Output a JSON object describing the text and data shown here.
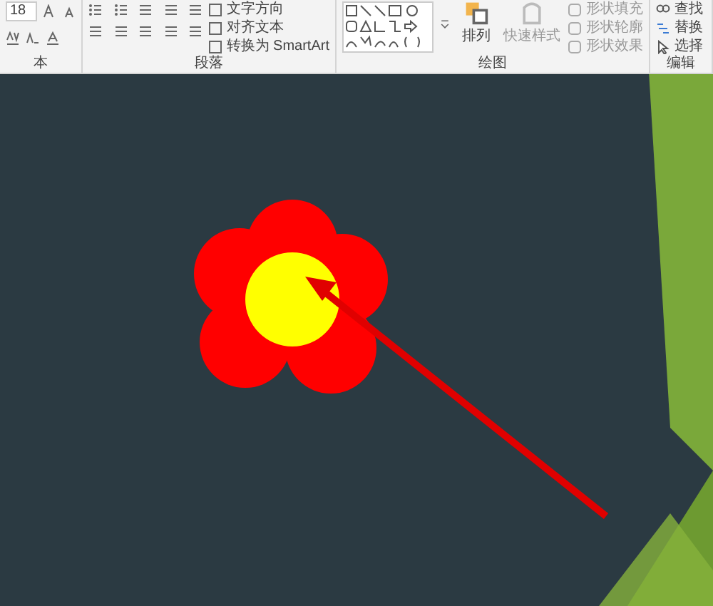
{
  "ribbon": {
    "font_group": {
      "font_size": "18",
      "label": "本"
    },
    "paragraph_group": {
      "commands": [
        "文字方向",
        "对齐文本",
        "转换为 SmartArt"
      ],
      "label": "段落"
    },
    "drawing_group": {
      "arrange": "排列",
      "quick_styles": "快速样式",
      "shape_commands": [
        "形状填充",
        "形状轮廓",
        "形状效果"
      ],
      "label": "绘图"
    },
    "editing_group": {
      "commands": [
        "查找",
        "替换",
        "选择"
      ],
      "label": "编辑"
    }
  }
}
